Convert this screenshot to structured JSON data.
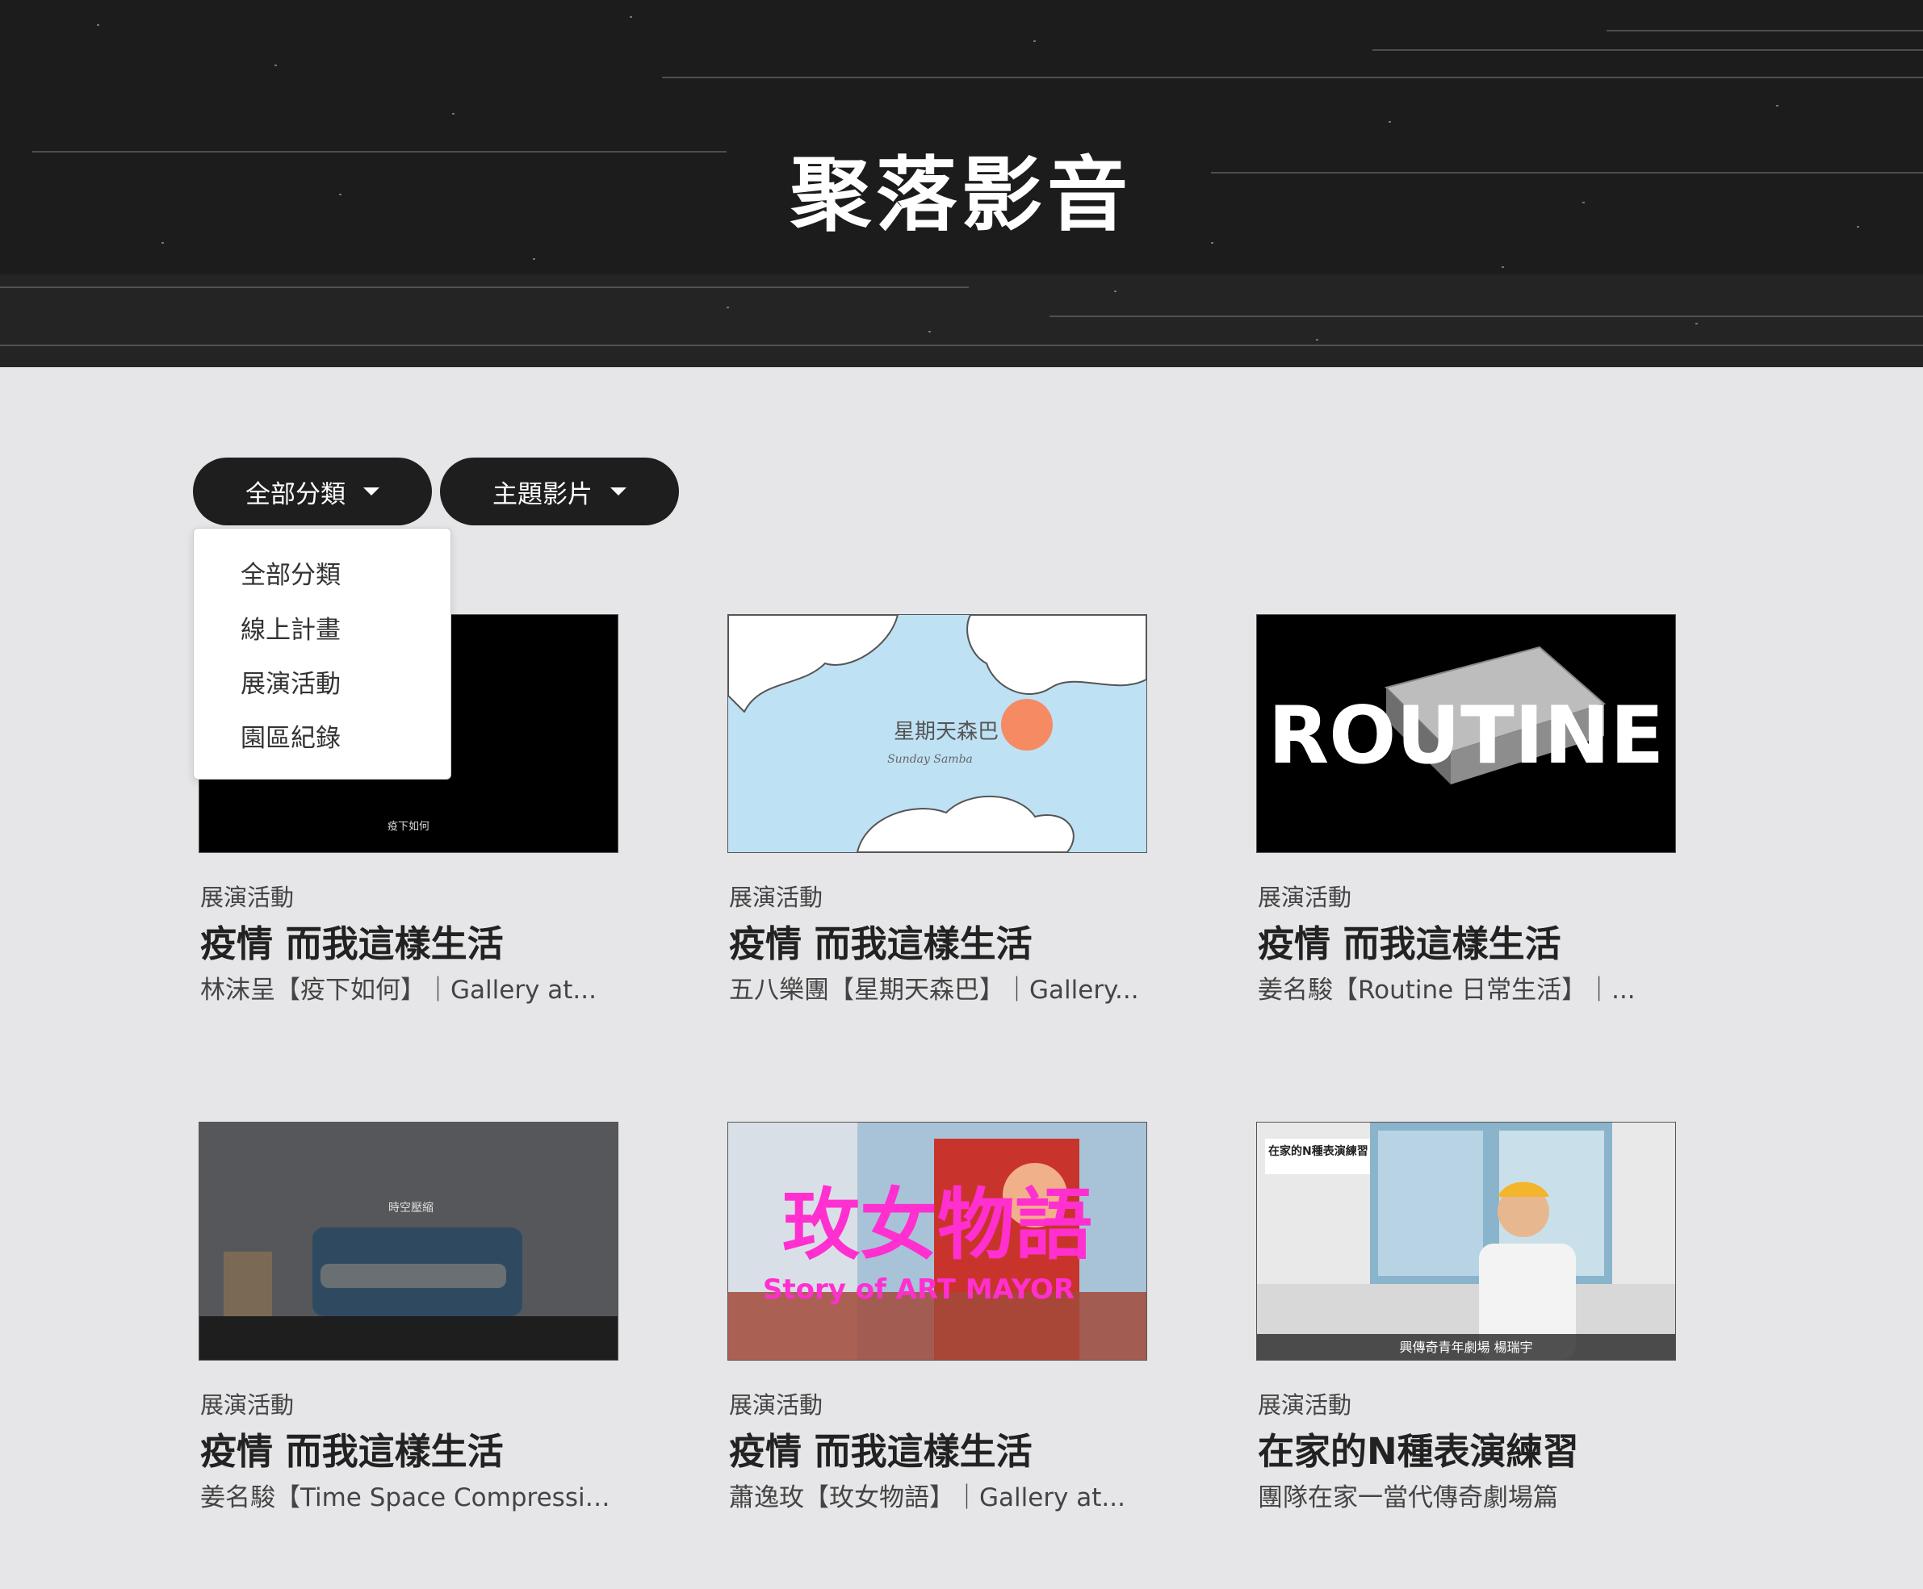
{
  "header": {
    "title": "聚落影音"
  },
  "filters": {
    "category_label": "全部分類",
    "theme_label": "主題影片",
    "dropdown_items": [
      "全部分類",
      "線上計畫",
      "展演活動",
      "園區紀錄"
    ]
  },
  "cards": [
    {
      "category": "展演活動",
      "title": "疫情 而我這樣生活",
      "desc": "林沫呈【疫下如何】｜Gallery at...",
      "thumb_caption": "疫下如何"
    },
    {
      "category": "展演活動",
      "title": "疫情 而我這樣生活",
      "desc": "五八樂團【星期天森巴】｜Gallery...",
      "thumb_caption": "星期天森巴",
      "thumb_sub": "Sunday Samba"
    },
    {
      "category": "展演活動",
      "title": "疫情 而我這樣生活",
      "desc": "姜名駿【Routine 日常生活】｜...",
      "thumb_caption": "ROUTINE"
    },
    {
      "category": "展演活動",
      "title": "疫情 而我這樣生活",
      "desc": "姜名駿【Time Space Compression...",
      "thumb_caption": "時空壓縮"
    },
    {
      "category": "展演活動",
      "title": "疫情 而我這樣生活",
      "desc": "蕭逸玫【玫女物語】｜Gallery at...",
      "thumb_caption": "玫女物語",
      "thumb_sub": "Story of ART MAYOR"
    },
    {
      "category": "展演活動",
      "title": "在家的N種表演練習",
      "desc": "團隊在家一當代傳奇劇場篇",
      "thumb_caption": "在家的N種表演練習",
      "thumb_sub": "興傳奇青年劇場 楊瑞宇"
    }
  ]
}
